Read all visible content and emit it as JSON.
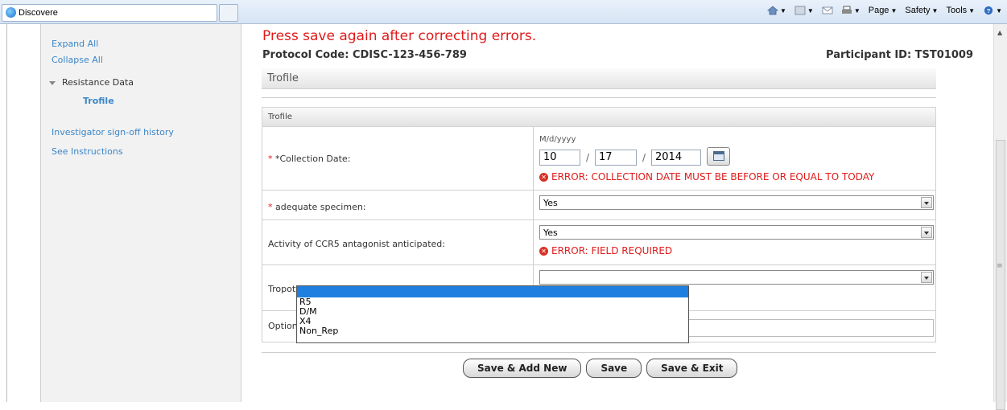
{
  "browser": {
    "tab_title": "Discovere",
    "commands": [
      "Page",
      "Safety",
      "Tools"
    ]
  },
  "sidebar": {
    "expand_all": "Expand All",
    "collapse_all": "Collapse All",
    "tree_item": "Resistance Data",
    "tree_subitem": "Trofile",
    "signoff_link": "Investigator sign-off history",
    "instructions_link": "See Instructions"
  },
  "main": {
    "error_banner": "Press save again after correcting errors.",
    "protocol": "Protocol Code: CDISC-123-456-789",
    "participant": "Participant ID: TST01009",
    "section_title": "Trofile",
    "form_title": "Trofile"
  },
  "form": {
    "collection_date": {
      "required_mark": "*",
      "label": "*Collection Date:",
      "format": "M/d/yyyy",
      "month": "10",
      "day": "17",
      "year": "2014",
      "separator": "/",
      "error": "ERROR: COLLECTION DATE MUST BE BEFORE OR EQUAL TO TODAY"
    },
    "adequate_specimen": {
      "required_mark": "*",
      "label": "adequate specimen:",
      "value": "Yes"
    },
    "ccr5": {
      "label": "Activity of CCR5 antagonist anticipated:",
      "value": "Yes",
      "error": "ERROR: FIELD REQUIRED"
    },
    "tropotype": {
      "label": "Tropotype Result:",
      "value": "",
      "options": [
        "",
        "R5",
        "D/M",
        "X4",
        "Non_Rep"
      ]
    },
    "options": {
      "label": "Options:"
    }
  },
  "buttons": {
    "save_add_new": "Save & Add New",
    "save": "Save",
    "save_exit": "Save & Exit"
  }
}
